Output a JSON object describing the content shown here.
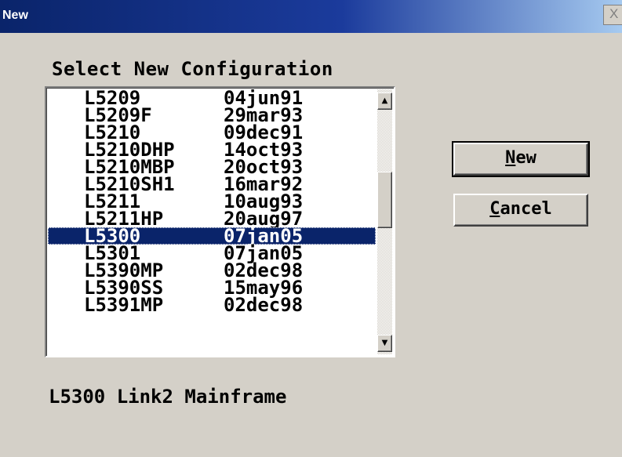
{
  "window": {
    "title": "New",
    "close_glyph": "X"
  },
  "dialog": {
    "label": "Select New Configuration"
  },
  "configurations": {
    "rows": [
      {
        "name": "L5209",
        "date": "04jun91"
      },
      {
        "name": "L5209F",
        "date": "29mar93"
      },
      {
        "name": "L5210",
        "date": "09dec91"
      },
      {
        "name": "L5210DHP",
        "date": "14oct93"
      },
      {
        "name": "L5210MBP",
        "date": "20oct93"
      },
      {
        "name": "L5210SH1",
        "date": "16mar92"
      },
      {
        "name": "L5211",
        "date": "10aug93"
      },
      {
        "name": "L5211HP",
        "date": "20aug97"
      },
      {
        "name": "L5300",
        "date": "07jan05"
      },
      {
        "name": "L5301",
        "date": "07jan05"
      },
      {
        "name": "L5390MP",
        "date": "02dec98"
      },
      {
        "name": "L5390SS",
        "date": "15may96"
      },
      {
        "name": "L5391MP",
        "date": "02dec98"
      }
    ],
    "selected_index": 8
  },
  "scrollbar": {
    "up_glyph": "▲",
    "down_glyph": "▼"
  },
  "buttons": {
    "new": {
      "accel": "N",
      "rest": "ew"
    },
    "cancel": {
      "accel": "C",
      "rest": "ancel"
    }
  },
  "status": {
    "text": "L5300 Link2 Mainframe"
  },
  "colors": {
    "title_gradient_start": "#0a246a",
    "title_gradient_end": "#a6caf0",
    "selection_bg": "#0a246a",
    "dialog_bg": "#d4d0c8"
  },
  "icons": {
    "close": "close-icon",
    "scroll_up": "scroll-up-icon",
    "scroll_down": "scroll-down-icon"
  }
}
